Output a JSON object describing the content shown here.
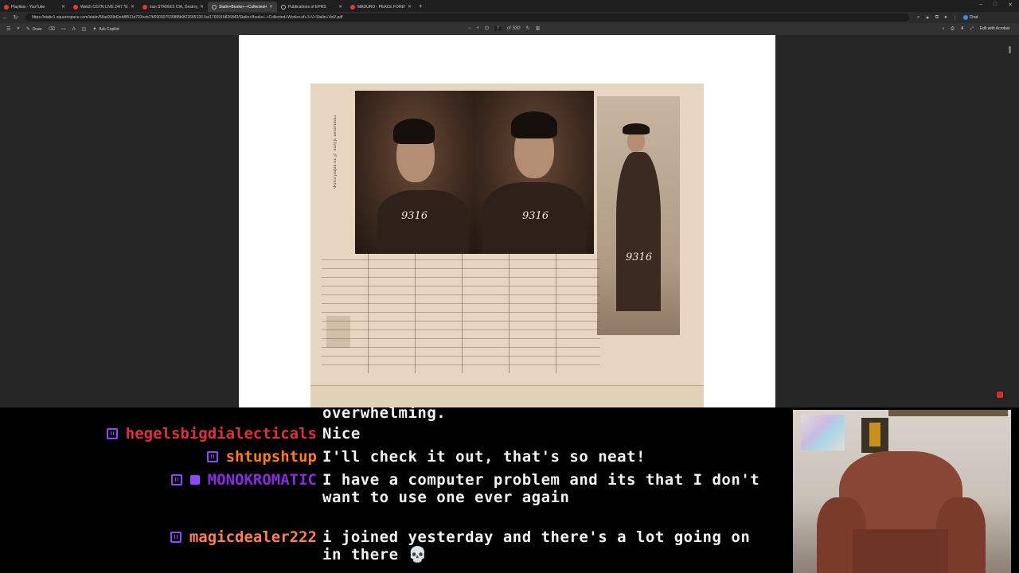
{
  "browser": {
    "tabs": [
      {
        "label": "Playlists - YouTube",
        "active": false
      },
      {
        "label": "Watch CGTN LIVE 24/7 *EXTE",
        "active": false
      },
      {
        "label": "Iran STRIKES CIA, Destroys SPAC",
        "active": false
      },
      {
        "label": "Stalin+Books+-+Collected+Works",
        "active": true
      },
      {
        "label": "Publications of EPRS",
        "active": false
      },
      {
        "label": "MADURO - PEACE FOREVER (OFF",
        "active": false
      }
    ],
    "url": "https://static1.squarespace.com/static/58ad338d2eb8f511d702ecb7/t/6909075308f8b9f22665193 5a/1760915826840/Stalin+Books+-+Collected+Works+of+J+V+Stalin+Vol2.pdf",
    "chat_button": "Chat"
  },
  "pdf_toolbar": {
    "draw_label": "Draw",
    "copilot_label": "Ask Copilot",
    "page_current": "7",
    "page_total": "of 330",
    "acrobat_label": "Edit with Acrobat"
  },
  "document": {
    "card_numbers": [
      "9316",
      "9316",
      "9316"
    ]
  },
  "chat": {
    "messages": [
      {
        "user": "",
        "color": "#ffffff",
        "text": "overwhelming."
      },
      {
        "user": "hegelsbigdialecticals",
        "color": "#e0303a",
        "text": "Nice"
      },
      {
        "user": "shtupshtup",
        "color": "#ff7a1a",
        "text": "I'll check it out, that's so neat!"
      },
      {
        "user": "MONOKROMATIC",
        "color": "#8a2be2",
        "text": "I have a computer problem and its that I don't want to use one ever again"
      },
      {
        "user": "magicdealer222",
        "color": "#ff7f50",
        "text": "i joined yesterday and there's a lot going on in there 💀"
      }
    ]
  }
}
